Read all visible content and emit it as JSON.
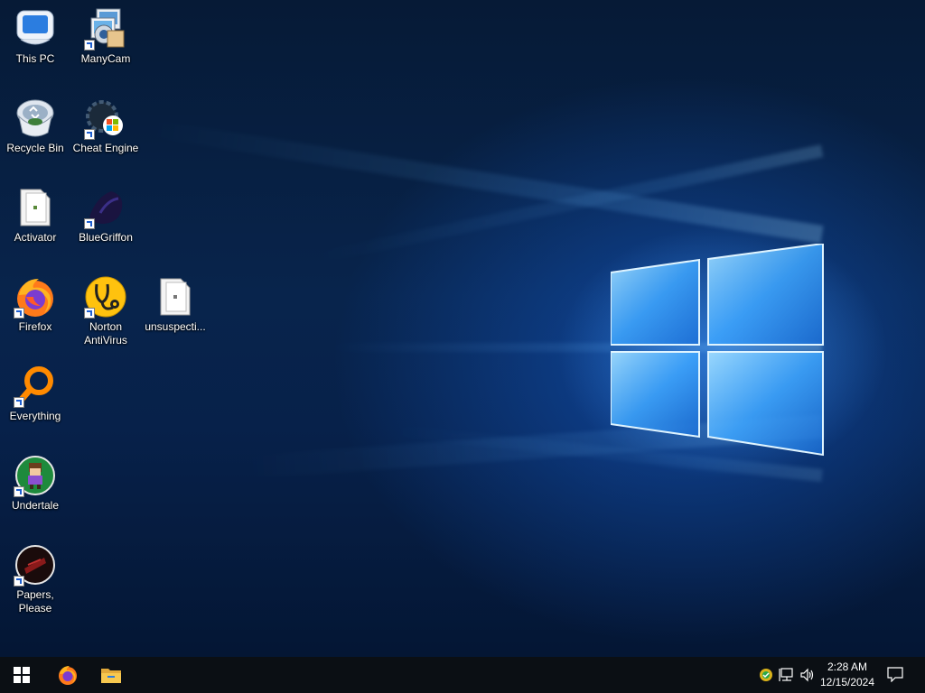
{
  "desktop": {
    "icons": [
      {
        "label": "This PC",
        "icon": "this-pc-icon"
      },
      {
        "label": "ManyCam",
        "icon": "manycam-icon"
      },
      {
        "label": "Recycle Bin",
        "icon": "recycle-bin-icon"
      },
      {
        "label": "Cheat Engine",
        "icon": "cheat-engine-icon"
      },
      {
        "label": "Activator",
        "icon": "file-icon"
      },
      {
        "label": "BlueGriffon",
        "icon": "bluegriffon-icon"
      },
      {
        "label": "Firefox",
        "icon": "firefox-icon"
      },
      {
        "label": "Norton AntiVirus",
        "icon": "norton-antivirus-icon"
      },
      {
        "label": "unsuspecti...",
        "icon": "file-icon"
      },
      {
        "label": "Everything",
        "icon": "everything-search-icon"
      },
      {
        "label": "Undertale",
        "icon": "undertale-icon"
      },
      {
        "label": "Papers, Please",
        "icon": "papers-please-icon"
      }
    ]
  },
  "taskbar": {
    "start": "start-button",
    "pinned": [
      "firefox",
      "file-explorer"
    ],
    "clock": {
      "time": "2:28 AM",
      "date": "12/15/2024"
    }
  },
  "colors": {
    "taskbar": "#0b0f14",
    "accent": "#1f7ae0"
  }
}
